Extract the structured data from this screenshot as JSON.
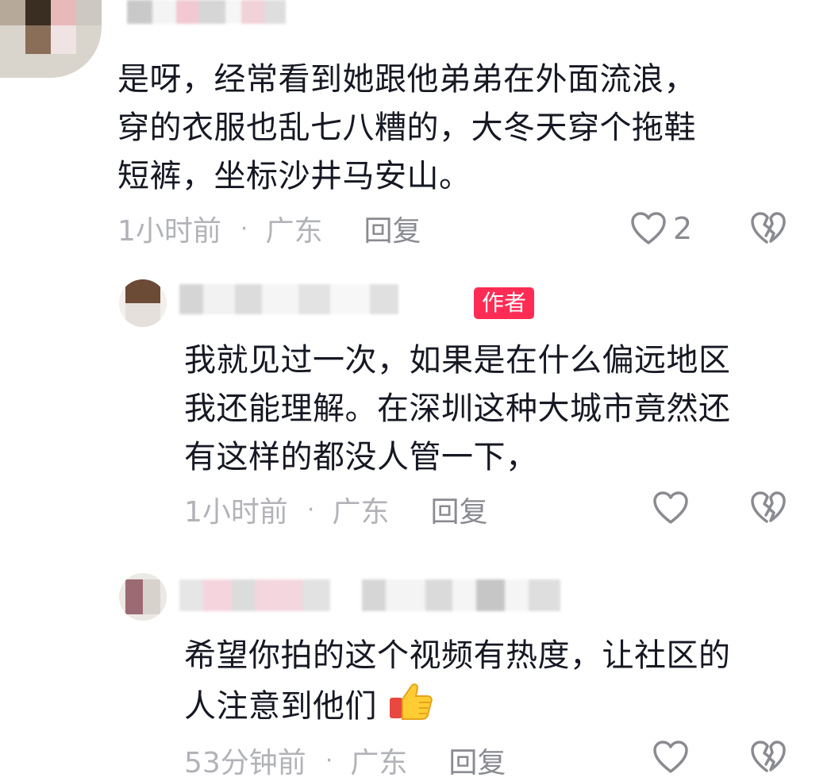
{
  "comments": [
    {
      "text_lines": [
        "是呀，经常看到她跟他弟弟在外面流浪，",
        "穿的衣服也乱七八糟的，大冬天穿个拖鞋",
        "短裤，坐标沙井马安山。"
      ],
      "time": "1小时前",
      "dot": "·",
      "location": "广东",
      "reply_label": "回复",
      "like_count": "2"
    },
    {
      "author_badge": "作者",
      "text_lines": [
        "我就见过一次，如果是在什么偏远地区",
        "我还能理解。在深圳这种大城市竟然还",
        "有这样的都没人管一下，"
      ],
      "time": "1小时前",
      "dot": "·",
      "location": "广东",
      "reply_label": "回复",
      "like_count": ""
    },
    {
      "text_lines": [
        "希望你拍的这个视频有热度，让社区的",
        "人注意到他们"
      ],
      "emoji": "thumbs-up-emoji",
      "time": "53分钟前",
      "dot": "·",
      "location": "广东",
      "reply_label": "回复",
      "like_count": ""
    }
  ],
  "colors": {
    "text": "#161823",
    "meta": "#b2b3b8",
    "icon": "#8a8b91",
    "badge": "#fe2c55"
  },
  "icons": [
    "heart-outline-icon",
    "broken-heart-icon"
  ]
}
